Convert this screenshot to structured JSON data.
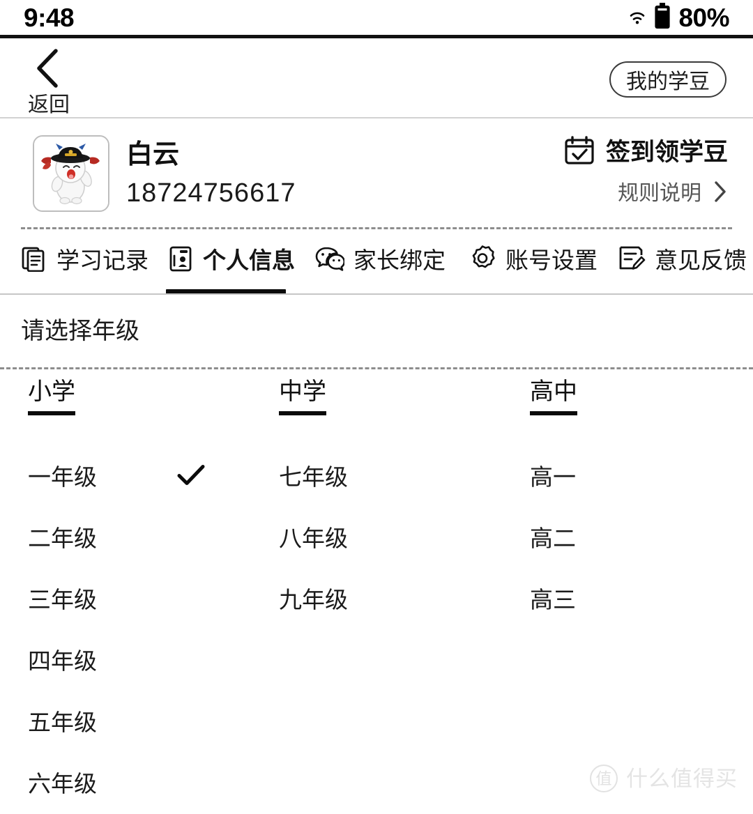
{
  "status_bar": {
    "time": "9:48",
    "wifi_icon": "wifi-icon",
    "battery_icon": "battery-icon",
    "battery_text": "80%"
  },
  "nav_bar": {
    "back_icon": "chevron-left-icon",
    "back_label": "返回",
    "coin_button_label": "我的学豆"
  },
  "profile": {
    "avatar_icon": "user-avatar-cartoon",
    "name": "白云",
    "phone": "18724756617",
    "signin": {
      "icon": "calendar-check-icon",
      "label": "签到领学豆"
    },
    "rule": {
      "label": "规则说明",
      "icon": "chevron-right-icon"
    }
  },
  "tabs": [
    {
      "label": "学习记录",
      "icon": "document-icon",
      "active": false
    },
    {
      "label": "个人信息",
      "icon": "id-card-icon",
      "active": true
    },
    {
      "label": "家长绑定",
      "icon": "wechat-icon",
      "active": false
    },
    {
      "label": "账号设置",
      "icon": "gear-icon",
      "active": false
    },
    {
      "label": "意见反馈",
      "icon": "feedback-edit-icon",
      "active": false
    }
  ],
  "section": {
    "title": "请选择年级"
  },
  "grade_columns": [
    {
      "header": "小学",
      "items": [
        {
          "label": "一年级",
          "selected": true
        },
        {
          "label": "二年级",
          "selected": false
        },
        {
          "label": "三年级",
          "selected": false
        },
        {
          "label": "四年级",
          "selected": false
        },
        {
          "label": "五年级",
          "selected": false
        },
        {
          "label": "六年级",
          "selected": false
        }
      ]
    },
    {
      "header": "中学",
      "items": [
        {
          "label": "七年级",
          "selected": false
        },
        {
          "label": "八年级",
          "selected": false
        },
        {
          "label": "九年级",
          "selected": false
        }
      ]
    },
    {
      "header": "高中",
      "items": [
        {
          "label": "高一",
          "selected": false
        },
        {
          "label": "高二",
          "selected": false
        },
        {
          "label": "高三",
          "selected": false
        }
      ]
    }
  ],
  "watermark": {
    "mark": "值",
    "text": "什么值得买"
  },
  "colors": {
    "text": "#1a1a1a",
    "muted": "#565656",
    "accent": "#0b0b0b",
    "divider": "#8d8d8d",
    "watermark": "#e4e4e4"
  }
}
